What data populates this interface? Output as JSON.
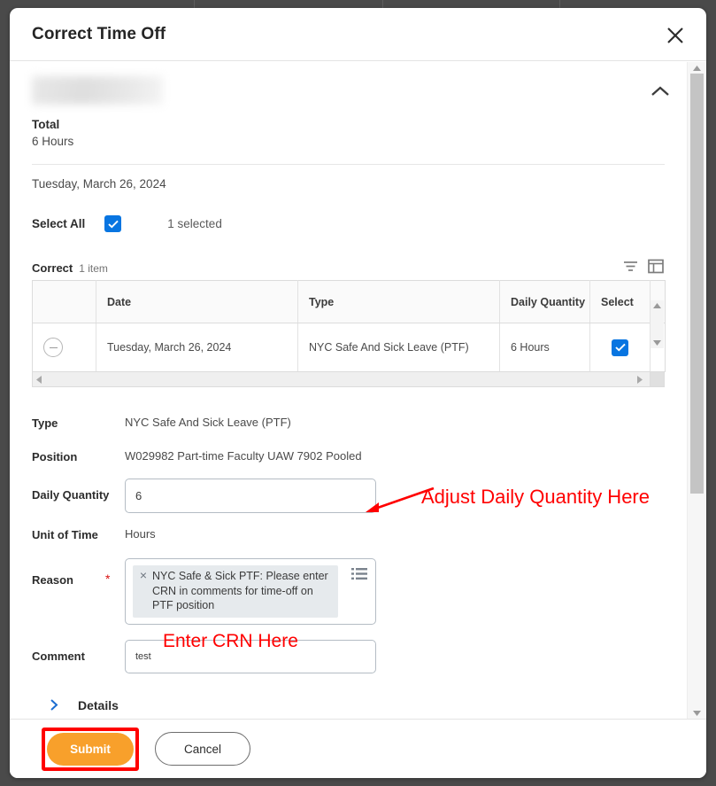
{
  "modal": {
    "title": "Correct Time Off",
    "close_icon": "close-icon",
    "collapse_icon": "chevron-up-icon"
  },
  "summary": {
    "redacted_name": "",
    "total_label": "Total",
    "total_value": "6 Hours",
    "date": "Tuesday, March 26, 2024"
  },
  "selection": {
    "select_all_label": "Select All",
    "checked": true,
    "selected_count": "1 selected"
  },
  "grid": {
    "title": "Correct",
    "count": "1 item",
    "filter_icon": "filter-icon",
    "view_icon": "grid-view-icon",
    "columns": [
      "",
      "Date",
      "Type",
      "Daily Quantity",
      "Select",
      ""
    ],
    "rows": [
      {
        "remove_icon": "minus-circle-icon",
        "date": "Tuesday, March 26, 2024",
        "type": "NYC Safe And Sick Leave (PTF)",
        "daily_quantity": "6 Hours",
        "selected": true
      }
    ]
  },
  "form": {
    "type_label": "Type",
    "type_value": "NYC Safe And Sick Leave (PTF)",
    "position_label": "Position",
    "position_value": "W029982 Part-time Faculty UAW 7902 Pooled",
    "daily_quantity_label": "Daily Quantity",
    "daily_quantity_value": "6",
    "unit_of_time_label": "Unit of Time",
    "unit_of_time_value": "Hours",
    "reason_label": "Reason",
    "reason_required": "*",
    "reason_pill": "NYC Safe & Sick PTF: Please enter CRN in comments for time-off on PTF position",
    "reason_pill_remove": "×",
    "reason_prompt_icon": "list-prompt-icon",
    "comment_label": "Comment",
    "comment_value": "test"
  },
  "details": {
    "label": "Details",
    "chevron_icon": "chevron-right-icon",
    "expanded": false
  },
  "footer": {
    "submit_label": "Submit",
    "cancel_label": "Cancel"
  },
  "annotations": {
    "daily_quantity_note": "Adjust Daily Quantity Here",
    "crn_note": "Enter CRN Here",
    "highlight_color": "#ff0000",
    "annotation_color": "#ff0000"
  },
  "theme": {
    "primary_button": "#f8a02b",
    "checkbox_blue": "#0875e1",
    "link_blue": "#0875e1",
    "required_red": "#d81010"
  }
}
